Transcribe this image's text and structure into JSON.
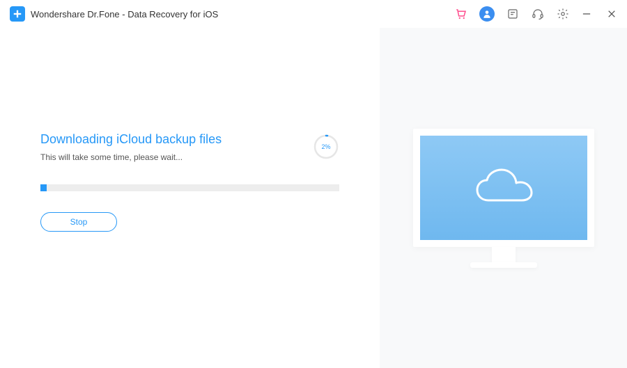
{
  "app": {
    "title": "Wondershare Dr.Fone - Data Recovery for iOS"
  },
  "colors": {
    "accent": "#2698f7",
    "cart": "#ff4d8d",
    "user_bg": "#3b8ef0"
  },
  "icons": {
    "cart": "cart-icon",
    "user": "user-icon",
    "feedback": "feedback-icon",
    "support": "support-icon",
    "settings": "settings-icon",
    "minimize": "minimize-icon",
    "close": "close-icon"
  },
  "task": {
    "title": "Downloading iCloud backup files",
    "subtitle": "This will take some time, please wait...",
    "progress_percent": 2,
    "progress_label": "2%",
    "stop_label": "Stop"
  },
  "illustration": {
    "name": "monitor-cloud-illustration"
  }
}
